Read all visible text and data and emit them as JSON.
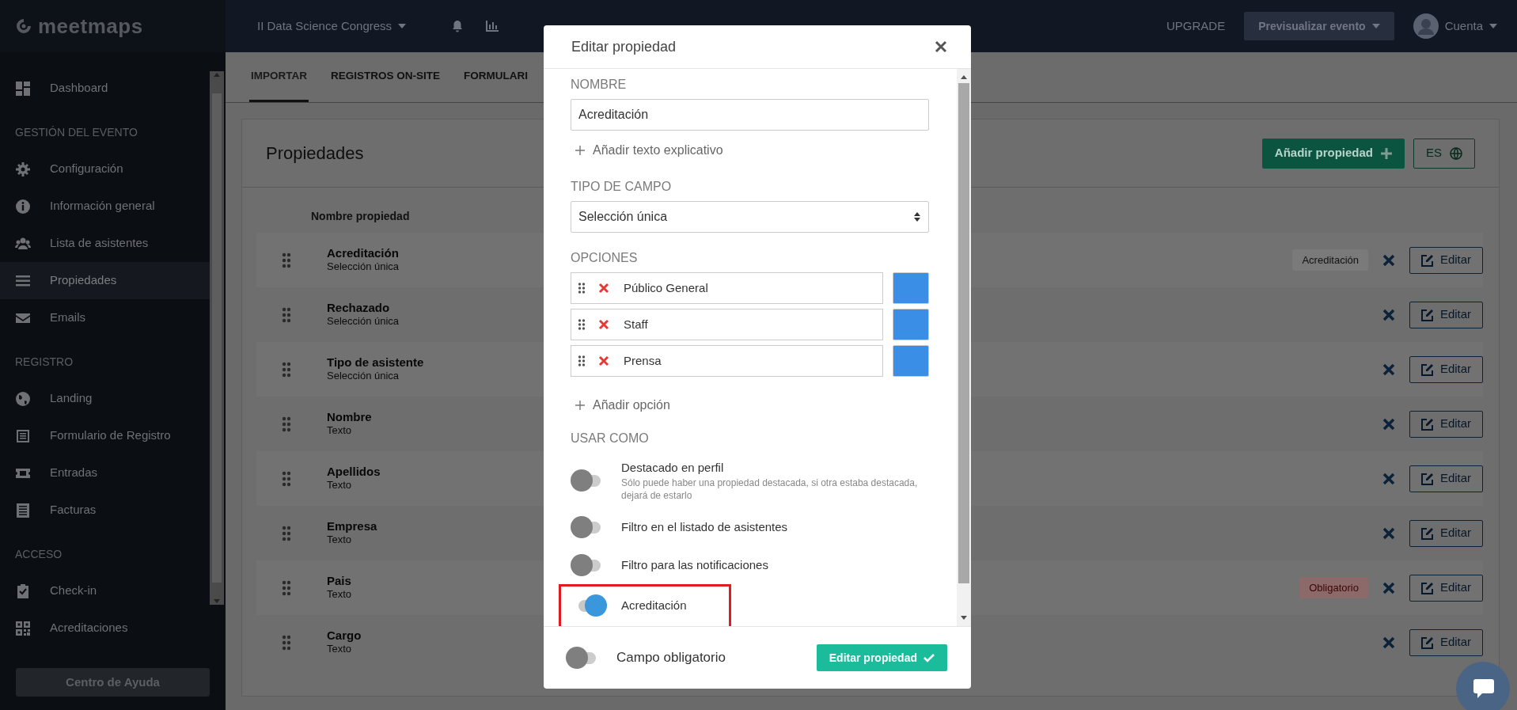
{
  "sidebar": {
    "logo": "meetmaps",
    "sections": [
      {
        "items": [
          {
            "label": "Dashboard",
            "selected": false
          }
        ]
      },
      {
        "title": "GESTIÓN DEL EVENTO",
        "items": [
          {
            "label": "Configuración",
            "selected": false
          },
          {
            "label": "Información general",
            "selected": false
          },
          {
            "label": "Lista de asistentes",
            "selected": false
          },
          {
            "label": "Propiedades",
            "selected": true
          },
          {
            "label": "Emails",
            "selected": false
          }
        ]
      },
      {
        "title": "REGISTRO",
        "items": [
          {
            "label": "Landing",
            "selected": false
          },
          {
            "label": "Formulario de Registro",
            "selected": false
          },
          {
            "label": "Entradas",
            "selected": false
          },
          {
            "label": "Facturas",
            "selected": false
          }
        ]
      },
      {
        "title": "ACCESO",
        "items": [
          {
            "label": "Check-in",
            "selected": false
          },
          {
            "label": "Acreditaciones",
            "selected": false
          }
        ]
      }
    ],
    "help_button": "Centro de Ayuda"
  },
  "topbar": {
    "event": "II Data Science Congress",
    "upgrade": "UPGRADE",
    "preview": "Previsualizar evento",
    "account": "Cuenta"
  },
  "tabs": [
    {
      "label": "IMPORTAR",
      "selected": true
    },
    {
      "label": "REGISTROS ON-SITE",
      "selected": false
    },
    {
      "label": "FORMULARI",
      "selected": false
    }
  ],
  "card": {
    "title": "Propiedades",
    "add_button": "Añadir propiedad",
    "language_button": "ES",
    "column": "Nombre propiedad",
    "rows": [
      {
        "name": "Acreditación",
        "type": "Selección única",
        "badge": {
          "text": "Acreditación",
          "kind": "tag"
        },
        "edit": "Editar"
      },
      {
        "name": "Rechazado",
        "type": "Selección única",
        "edit": "Editar"
      },
      {
        "name": "Tipo de asistente",
        "type": "Selección única",
        "edit": "Editar"
      },
      {
        "name": "Nombre",
        "type": "Texto",
        "edit": "Editar"
      },
      {
        "name": "Apellidos",
        "type": "Texto",
        "edit": "Editar"
      },
      {
        "name": "Empresa",
        "type": "Texto",
        "edit": "Editar"
      },
      {
        "name": "Pais",
        "type": "Texto",
        "badge": {
          "text": "Obligatorio",
          "kind": "required"
        },
        "edit": "Editar"
      },
      {
        "name": "Cargo",
        "type": "Texto",
        "edit": "Editar"
      }
    ]
  },
  "modal": {
    "title": "Editar propiedad",
    "name_label": "NOMBRE",
    "name_value": "Acreditación",
    "add_help": "Añadir texto explicativo",
    "type_label": "TIPO DE CAMPO",
    "type_value": "Selección única",
    "options_label": "OPCIONES",
    "options": [
      {
        "label": "Público General",
        "color": "#3a8ee6"
      },
      {
        "label": "Staff",
        "color": "#3a8ee6"
      },
      {
        "label": "Prensa",
        "color": "#3a8ee6"
      }
    ],
    "add_option": "Añadir opción",
    "usage_label": "USAR COMO",
    "usage": [
      {
        "label": "Destacado en perfil",
        "description": "Sólo puede haber una propiedad destacada, si otra estaba destacada, dejará de estarlo",
        "on": false,
        "highlighted": false
      },
      {
        "label": "Filtro en el listado de asistentes",
        "on": false,
        "highlighted": false
      },
      {
        "label": "Filtro para las notificaciones",
        "on": false,
        "highlighted": false
      },
      {
        "label": "Acreditación",
        "on": true,
        "highlighted": true
      }
    ],
    "required": {
      "label": "Campo obligatorio",
      "on": false
    },
    "submit": "Editar propiedad"
  }
}
